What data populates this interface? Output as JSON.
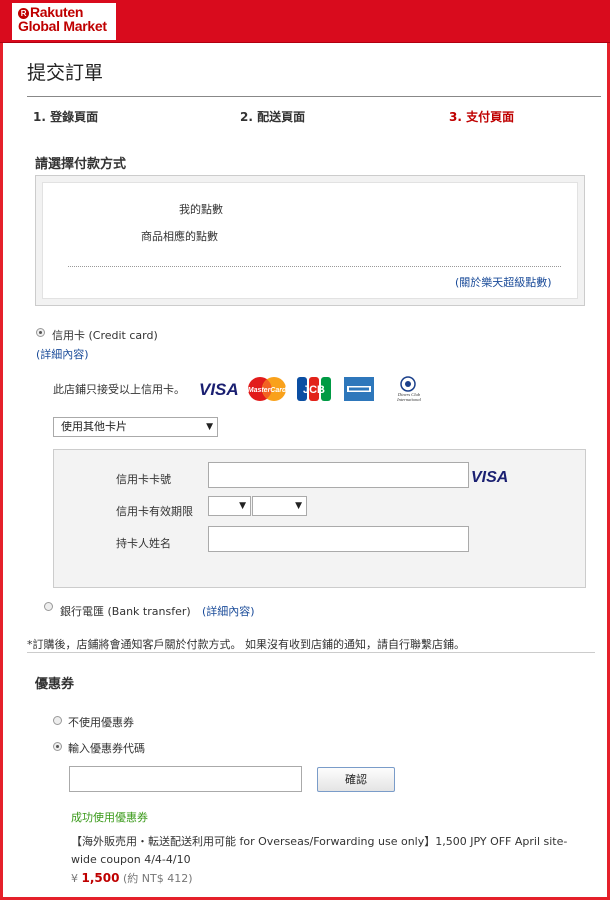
{
  "brand": {
    "line1": "Rakuten",
    "line2": "Global Market",
    "mark": "R",
    "color": "#bf0000"
  },
  "page_title": "提交訂單",
  "steps": [
    {
      "label": "1. 登錄頁面",
      "active": false
    },
    {
      "label": "2. 配送頁面",
      "active": false
    },
    {
      "label": "3. 支付頁面",
      "active": true
    }
  ],
  "payment": {
    "heading": "請選擇付款方式",
    "points": {
      "my_points": "我的點數",
      "product_points": "商品相應的點數",
      "about_link": "(關於樂天超級點數)"
    },
    "credit_card": {
      "label": "信用卡 (Credit card)",
      "details_link": "(詳細內容)",
      "accepted_text": "此店鋪只接受以上信用卡。",
      "card_logos": [
        "visa-logo",
        "mastercard-logo",
        "jcb-logo",
        "amex-logo",
        "diners-club-logo"
      ],
      "diners_text": "Diners Club International",
      "card_select_value": "使用其他卡片",
      "form": {
        "card_number_label": "信用卡卡號",
        "expiry_label": "信用卡有效期限",
        "holder_label": "持卡人姓名",
        "visa_badge": "VISA"
      }
    },
    "bank_transfer": {
      "label": "銀行電匯 (Bank transfer)",
      "details_link": "(詳細內容)"
    },
    "note": "*訂購後，店鋪將會通知客戶關於付款方式。 如果沒有收到店鋪的通知，請自行聯繫店鋪。"
  },
  "coupon": {
    "heading": "優惠券",
    "option_none": "不使用優惠券",
    "option_enter": "輸入優惠券代碼",
    "confirm_button": "確認",
    "success_text": "成功使用優惠券",
    "coupon_text": "【海外販売用・転送配送利用可能 for Overseas/Forwarding use only】1,500 JPY OFF April site-wide coupon 4/4-4/10",
    "price_symbol": "¥ ",
    "price_amount": "1,500",
    "price_approx": " (約 NT$ 412)"
  },
  "colors": {
    "accent_red": "#d90b1d",
    "link_blue": "#1a4b99",
    "success_green": "#3a9a1a"
  }
}
